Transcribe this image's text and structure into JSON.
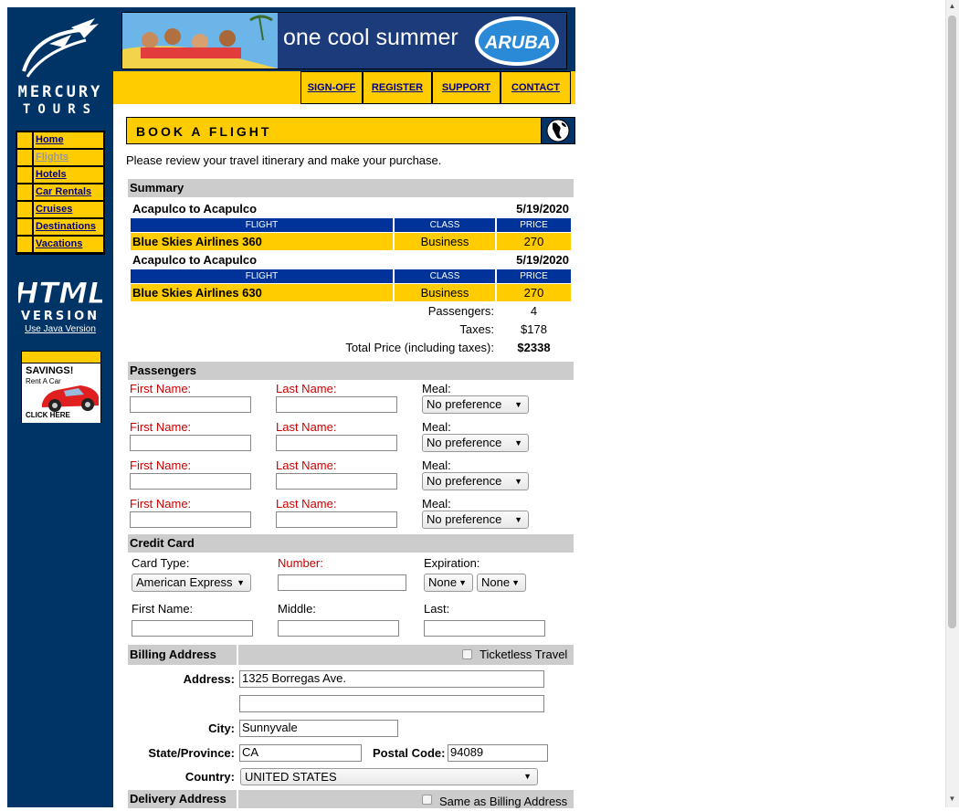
{
  "nav": {
    "logo_word1": "MERCURY",
    "logo_word2": "TOURS",
    "items": [
      {
        "label": "Home",
        "current": false
      },
      {
        "label": "Flights",
        "current": true
      },
      {
        "label": "Hotels",
        "current": false
      },
      {
        "label": "Car Rentals",
        "current": false
      },
      {
        "label": "Cruises",
        "current": false
      },
      {
        "label": "Destinations",
        "current": false
      },
      {
        "label": "Vacations",
        "current": false
      }
    ],
    "html_version_line1": "HTML",
    "html_version_line2": "VERSION",
    "java_link": "Use Java Version",
    "ad_title": "SAVINGS!",
    "ad_sub": "Rent A Car",
    "ad_cta": "CLICK HERE"
  },
  "banner": {
    "text": "one cool summer",
    "badge": "ARUBA"
  },
  "toplinks": [
    "SIGN-OFF",
    "REGISTER",
    "SUPPORT",
    "CONTACT"
  ],
  "page": {
    "title": "BOOK A FLIGHT",
    "intro": "Please review your travel itinerary and make your purchase."
  },
  "summary": {
    "header": "Summary",
    "col_flight": "FLIGHT",
    "col_class": "CLASS",
    "col_price": "PRICE",
    "legs": [
      {
        "route": "Acapulco to Acapulco",
        "date": "5/19/2020",
        "flight": "Blue Skies Airlines 360",
        "class": "Business",
        "price": "270"
      },
      {
        "route": "Acapulco to Acapulco",
        "date": "5/19/2020",
        "flight": "Blue Skies Airlines 630",
        "class": "Business",
        "price": "270"
      }
    ],
    "passengers_label": "Passengers:",
    "passengers_value": "4",
    "taxes_label": "Taxes:",
    "taxes_value": "$178",
    "total_label": "Total Price (including taxes):",
    "total_value": "$2338"
  },
  "passengers": {
    "header": "Passengers",
    "first_label": "First Name:",
    "last_label": "Last Name:",
    "meal_label": "Meal:",
    "meal_value": "No preference"
  },
  "credit": {
    "header": "Credit Card",
    "type_label": "Card Type:",
    "type_value": "American Express",
    "number_label": "Number:",
    "exp_label": "Expiration:",
    "exp_month": "None",
    "exp_year": "None",
    "first_label": "First Name:",
    "middle_label": "Middle:",
    "last_label": "Last:"
  },
  "billing": {
    "header": "Billing Address",
    "ticketless": "Ticketless Travel",
    "address_label": "Address:",
    "address_value": "1325 Borregas Ave.",
    "address2_value": "",
    "city_label": "City:",
    "city_value": "Sunnyvale",
    "state_label": "State/Province:",
    "state_value": "CA",
    "postal_label": "Postal Code:",
    "postal_value": "94089",
    "country_label": "Country:",
    "country_value": "UNITED STATES"
  },
  "delivery": {
    "header": "Delivery Address",
    "same_as": "Same as Billing Address"
  },
  "colors": {
    "navy": "#003366",
    "yellow": "#FFCC00",
    "table_head": "#003399",
    "section_gray": "#cccccc",
    "required_red": "#cc0000"
  }
}
